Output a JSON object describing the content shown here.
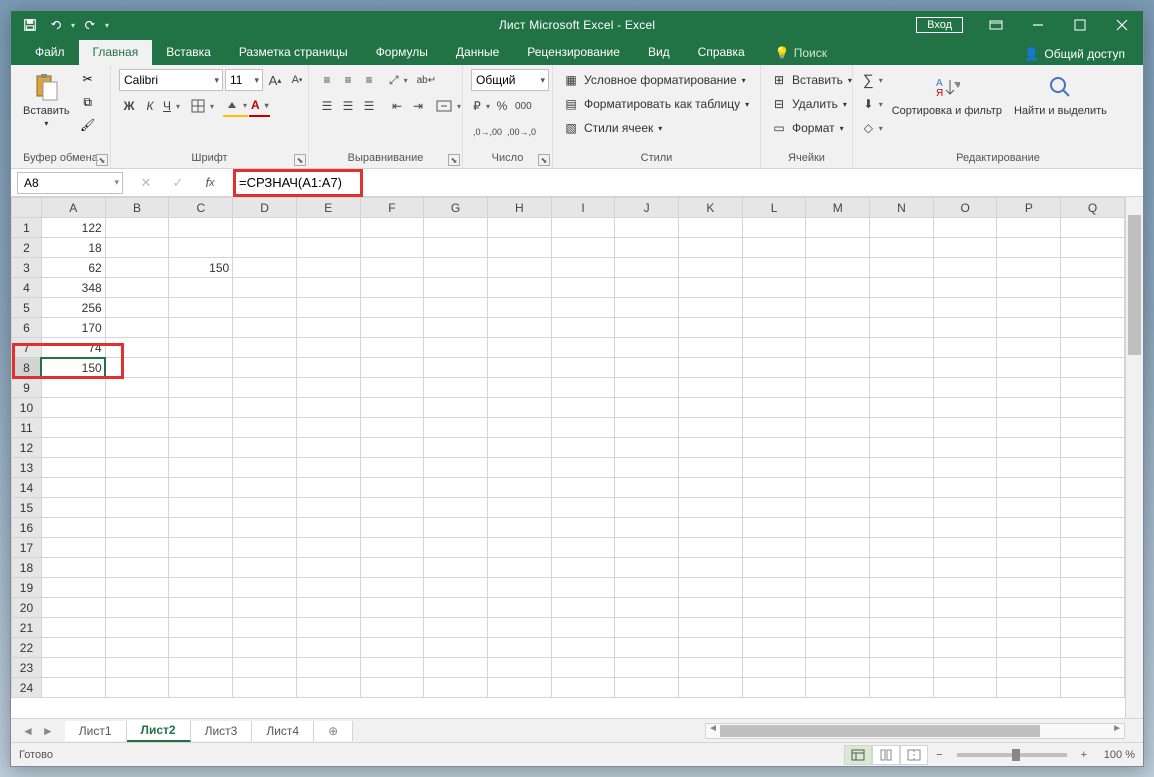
{
  "title": "Лист Microsoft Excel - Excel",
  "signin": "Вход",
  "tabs": {
    "file": "Файл",
    "items": [
      "Главная",
      "Вставка",
      "Разметка страницы",
      "Формулы",
      "Данные",
      "Рецензирование",
      "Вид",
      "Справка"
    ],
    "active": 0,
    "tell": "Поиск",
    "share": "Общий доступ"
  },
  "ribbon": {
    "clipboard": {
      "label": "Буфер обмена",
      "paste": "Вставить"
    },
    "font": {
      "label": "Шрифт",
      "name": "Calibri",
      "size": "11",
      "bold": "Ж",
      "italic": "К",
      "underline": "Ч"
    },
    "alignment": {
      "label": "Выравнивание"
    },
    "number": {
      "label": "Число",
      "format": "Общий"
    },
    "styles": {
      "label": "Стили",
      "cond": "Условное форматирование",
      "table": "Форматировать как таблицу",
      "cell": "Стили ячеек"
    },
    "cells": {
      "label": "Ячейки",
      "insert": "Вставить",
      "delete": "Удалить",
      "format": "Формат"
    },
    "editing": {
      "label": "Редактирование",
      "sort": "Сортировка и фильтр",
      "find": "Найти и выделить"
    }
  },
  "formula_bar": {
    "name_box": "A8",
    "formula": "=СРЗНАЧ(A1:A7)"
  },
  "columns": [
    "A",
    "B",
    "C",
    "D",
    "E",
    "F",
    "G",
    "H",
    "I",
    "J",
    "K",
    "L",
    "M",
    "N",
    "O",
    "P",
    "Q"
  ],
  "rows": 24,
  "selected_cell": "A8",
  "cells": {
    "A1": "122",
    "A2": "18",
    "A3": "62",
    "A4": "348",
    "A5": "256",
    "A6": "170",
    "A7": "74",
    "A8": "150",
    "C3": "150"
  },
  "sheet_tabs": {
    "items": [
      "Лист1",
      "Лист2",
      "Лист3",
      "Лист4"
    ],
    "active": 1
  },
  "status": {
    "ready": "Готово",
    "zoom": "100 %"
  }
}
